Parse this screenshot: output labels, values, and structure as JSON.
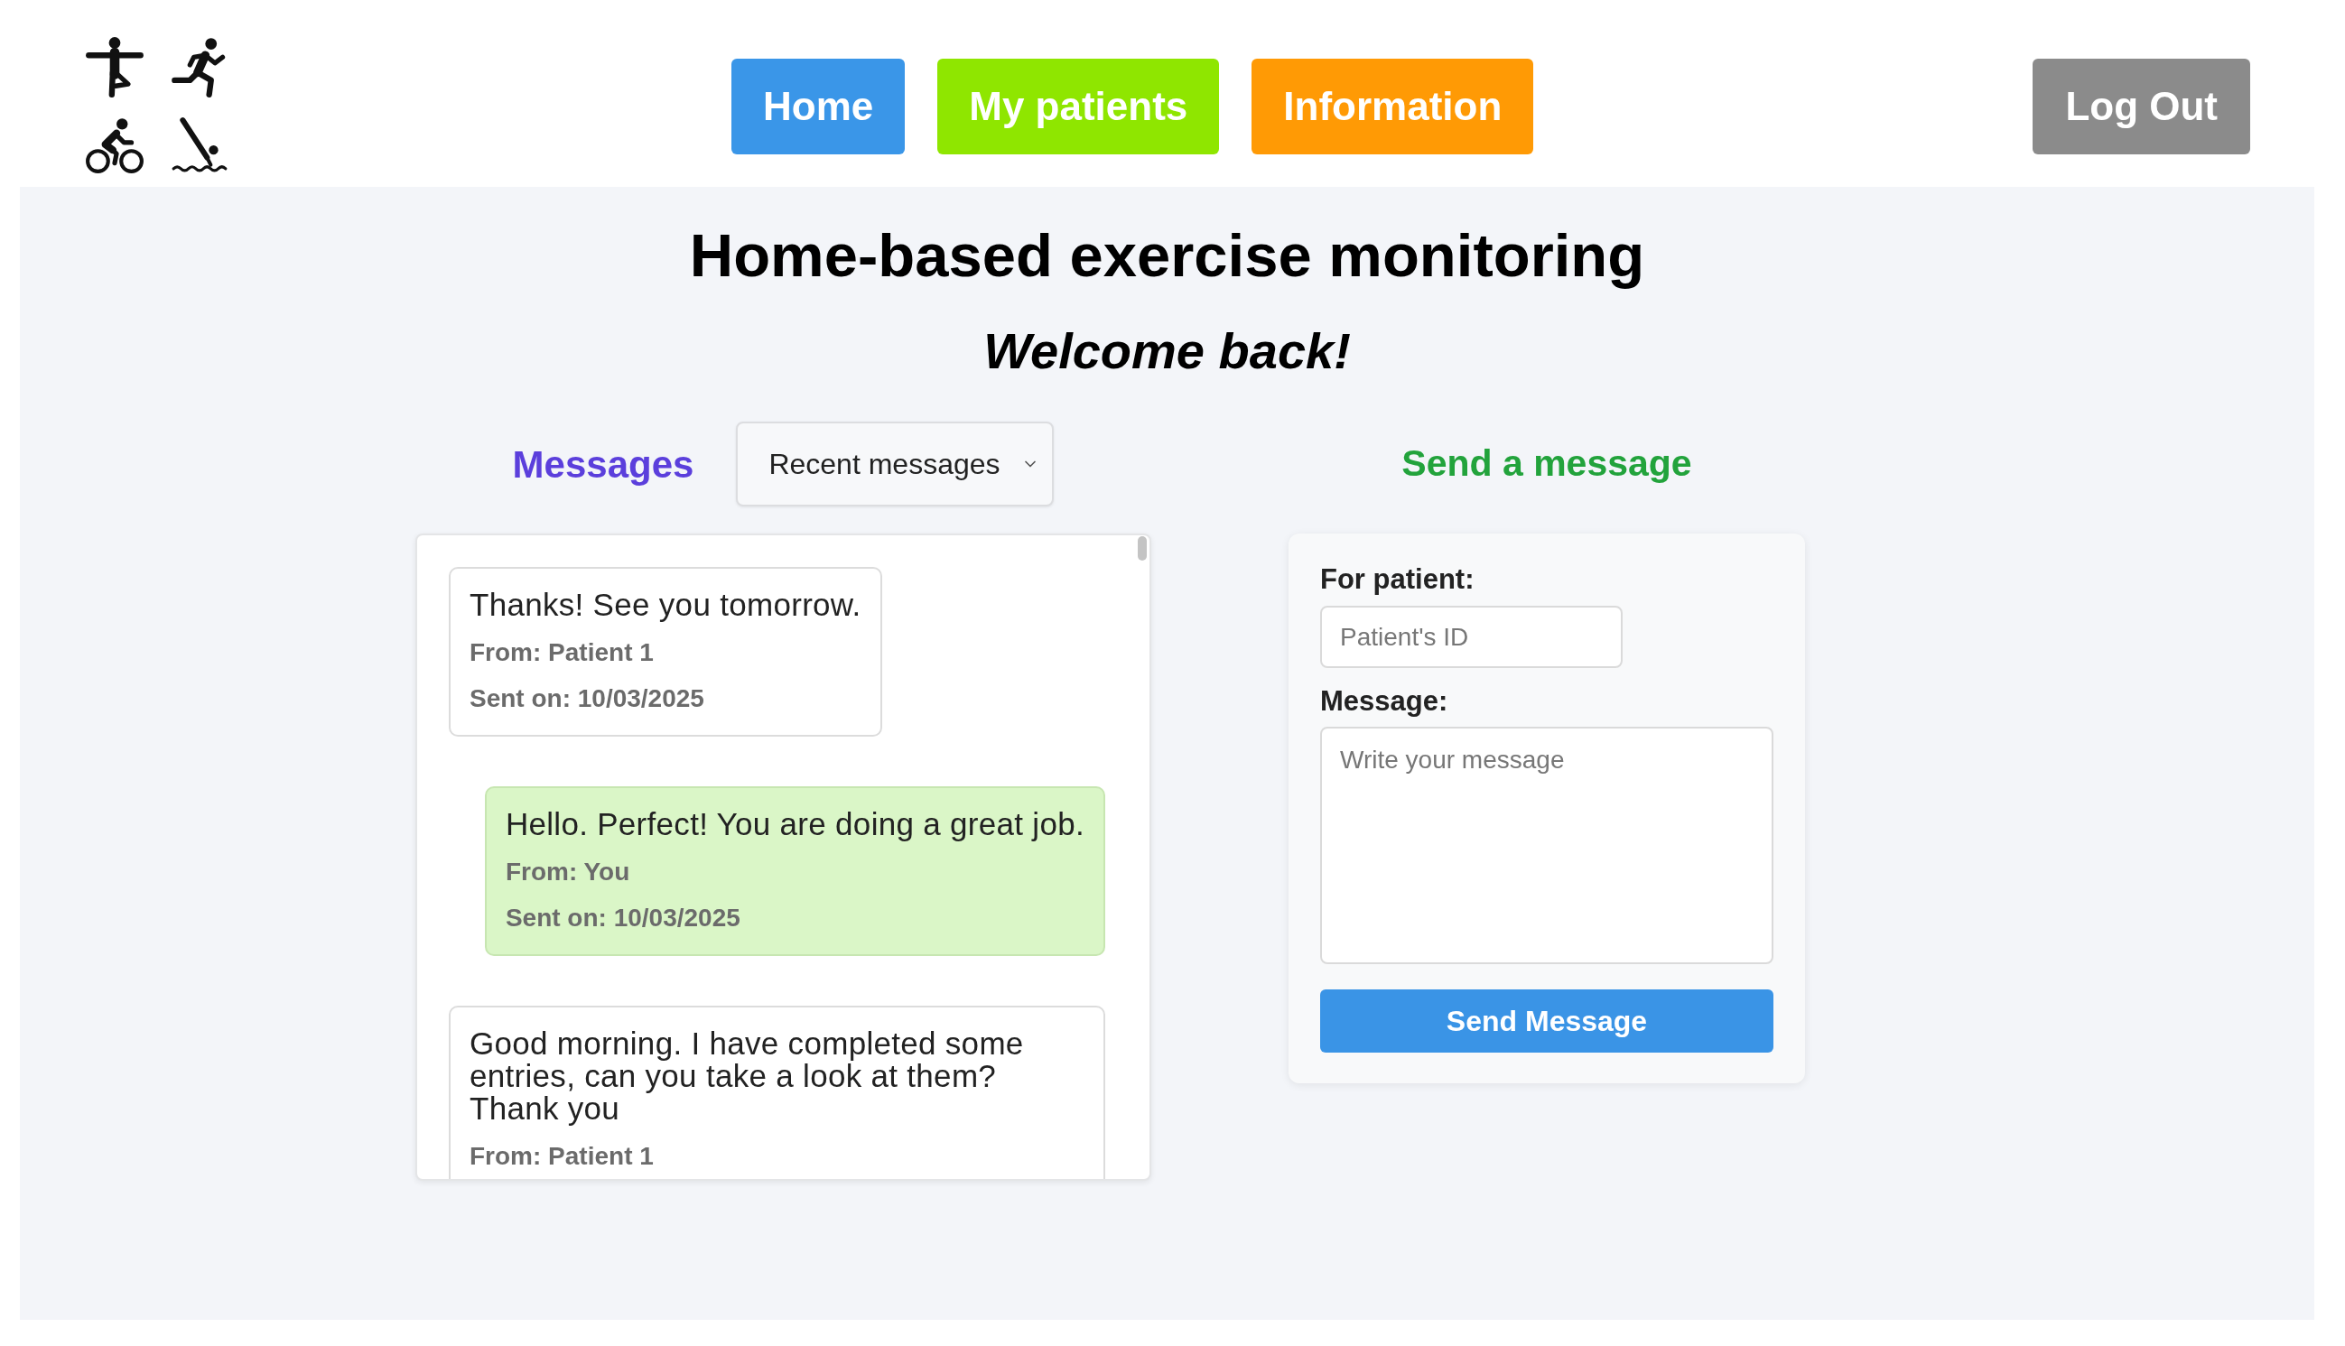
{
  "nav": [
    {
      "label": "Home",
      "color": "#3a96e8"
    },
    {
      "label": "My patients",
      "color": "#8fe600"
    },
    {
      "label": "Information",
      "color": "#ff9a05"
    }
  ],
  "logout": {
    "label": "Log Out"
  },
  "title": "Home-based exercise monitoring",
  "subtitle": "Welcome back!",
  "messages": {
    "heading": "Messages",
    "filter": {
      "value": "Recent messages"
    },
    "items": [
      {
        "text": "Thanks! See you tomorrow.",
        "from": "From: Patient 1",
        "sent_on": "Sent on: 10/03/2025",
        "outgoing": false
      },
      {
        "text": "Hello. Perfect! You are doing a great job.",
        "from": "From: You",
        "sent_on": "Sent on: 10/03/2025",
        "outgoing": true
      },
      {
        "text": "Good morning. I have completed some entries, can you take a look at them? Thank you",
        "from": "From: Patient 1",
        "outgoing": false
      }
    ]
  },
  "send_form": {
    "heading": "Send a message",
    "patient_label": "For patient:",
    "patient_input": {
      "placeholder": "Patient's ID"
    },
    "message_label": "Message:",
    "message_input": {
      "placeholder": "Write your message"
    },
    "submit": "Send Message"
  }
}
